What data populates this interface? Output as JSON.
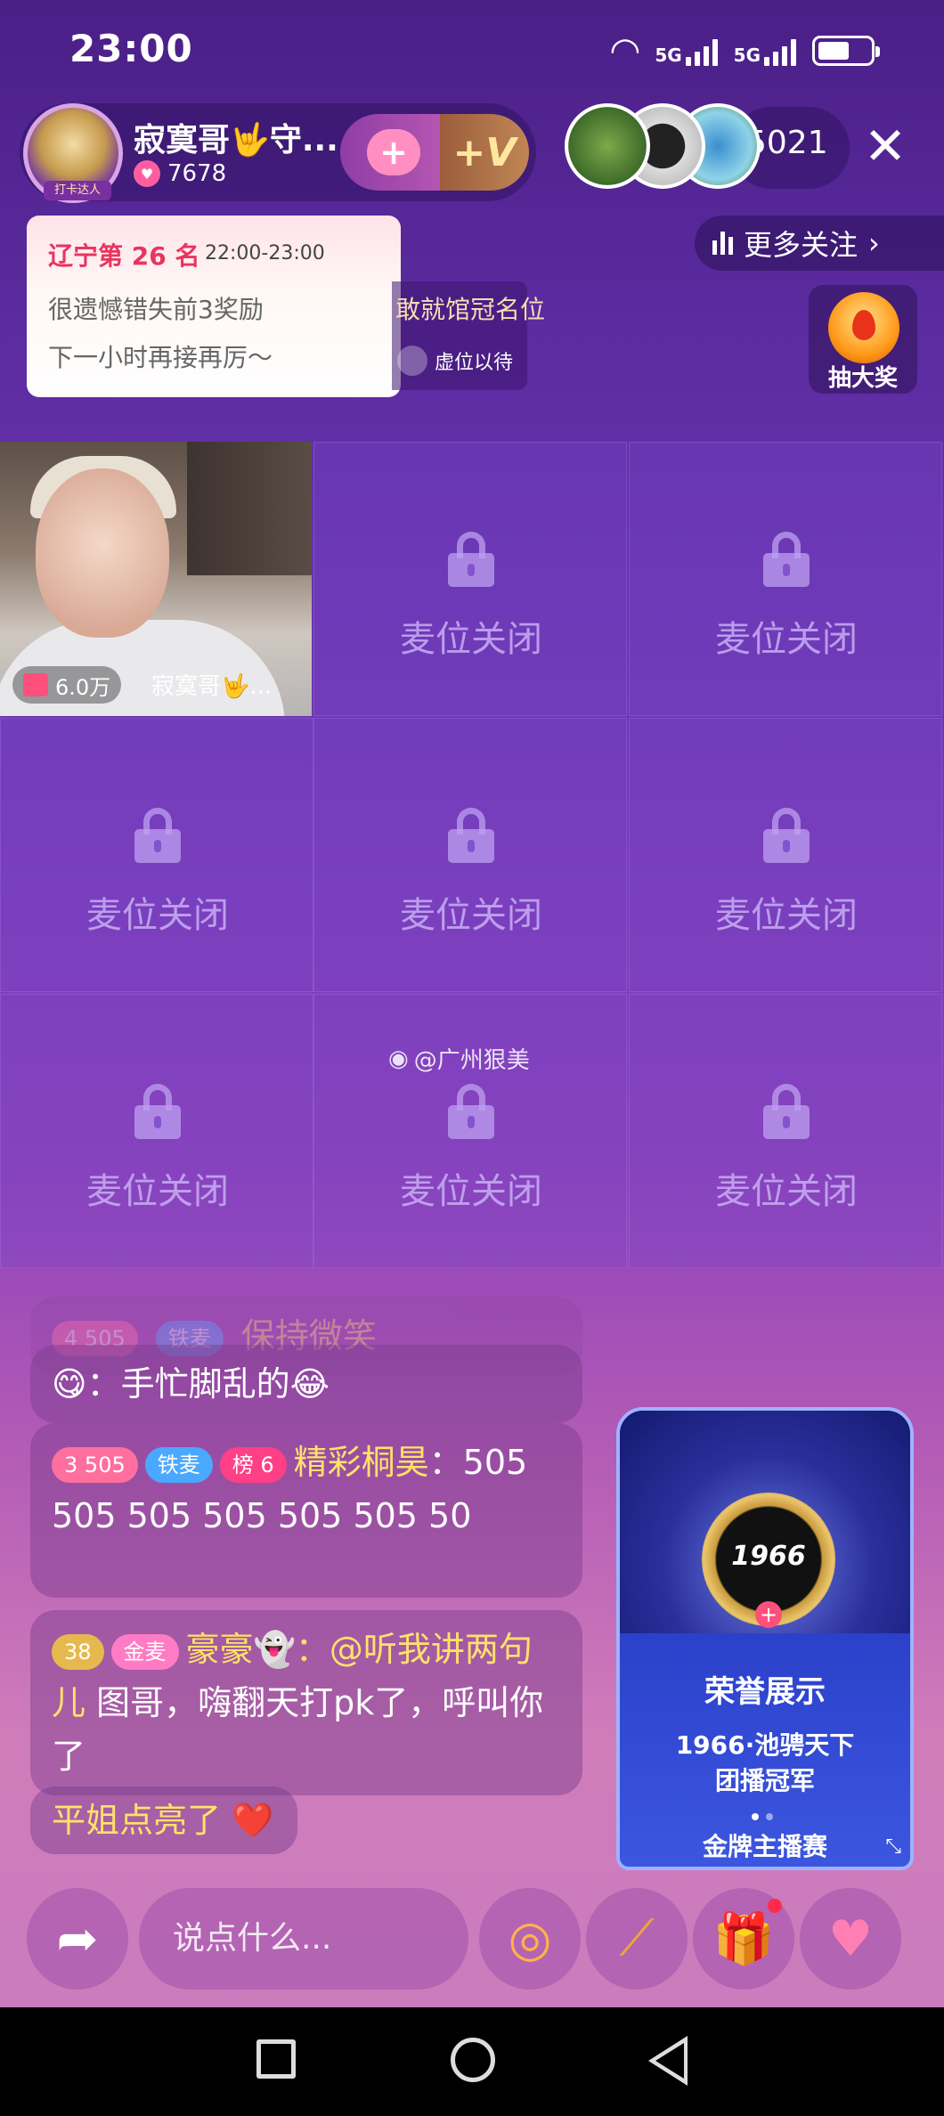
{
  "status_bar": {
    "time": "23:00",
    "net1": "5G",
    "net2": "5G",
    "battery_level": 0.6
  },
  "host": {
    "name": "寂寞哥🤟守...",
    "likes": "7678",
    "avatar_badge": "打卡达人",
    "favorite_label": "+",
    "vip_label": "+V"
  },
  "viewers": {
    "count": "5021"
  },
  "rank_popup": {
    "title": "辽宁第 26 名",
    "time": "22:00-23:00",
    "line1": "很遗憾错失前3奖励",
    "line2": "下一小时再接再厉～"
  },
  "champion_banner": {
    "text": "敢就馆冠名位",
    "virtual_seat": "虚位以待"
  },
  "more_follow": {
    "label": "更多关注"
  },
  "lottery": {
    "label": "抽大奖"
  },
  "mic_grid": {
    "host_seat": {
      "gift_value": "6.0万",
      "name": "寂寞哥🤟..."
    },
    "closed_label": "麦位关闭"
  },
  "watermark": "@广州狠美",
  "chat": [
    {
      "level": "4",
      "score": "505",
      "badge": "铁麦",
      "text": "保持微笑"
    },
    {
      "text": "😋：手忙脚乱的😂"
    },
    {
      "level": "3",
      "score": "505",
      "badge": "铁麦",
      "rank": "榜 6",
      "name": "精彩桐昊",
      "message": "：505 505 505 505 505 505 50"
    },
    {
      "level": "38",
      "badge": "金麦",
      "name": "豪豪👻",
      "mention": "：@听我讲两句儿",
      "message": " 图哥，嗨翻天打pk了，呼叫你了"
    },
    {
      "text": "平姐点亮了 ❤️"
    }
  ],
  "honor_card": {
    "medal": "1966",
    "title": "荣誉展示",
    "line1": "1966·池骋天下",
    "line2": "团播冠军",
    "footer": "金牌主播赛"
  },
  "bottom_bar": {
    "input_placeholder": "说点什么..."
  },
  "icons": [
    "share-icon",
    "target-icon",
    "wand-icon",
    "gift-icon",
    "heart-plus-icon",
    "lock-icon",
    "close-icon",
    "chevron-right-icon",
    "weibo-icon"
  ]
}
